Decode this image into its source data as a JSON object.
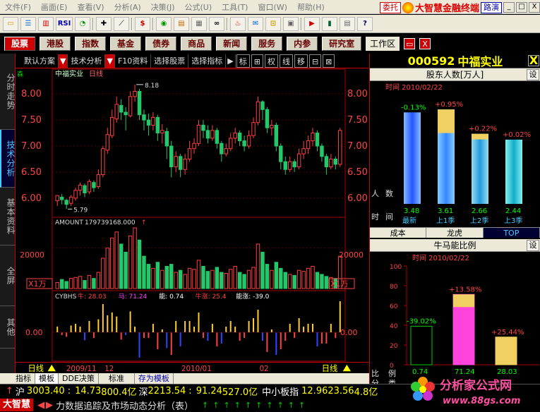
{
  "menu": {
    "items": [
      "文件(F)",
      "画面(E)",
      "查看(V)",
      "分析(A)",
      "决策(J)",
      "公式(U)",
      "工具(T)",
      "窗口(W)",
      "帮助(H)"
    ],
    "weituo": "委托",
    "brand": "大智慧金融终端",
    "luyan": "路演",
    "win_min": "_",
    "win_max": "□",
    "win_close": "X"
  },
  "toolbar": {
    "rsi_label": "RSI",
    "dollar_label": "$"
  },
  "categories": [
    "股票",
    "港股",
    "指数",
    "基金",
    "债券",
    "商品",
    "新闻",
    "服务",
    "内参",
    "研究室"
  ],
  "workarea": {
    "label": "工作区",
    "restore": "▭",
    "close": "X"
  },
  "sidetabs": [
    "分时走势",
    "技术分析",
    "基本资料",
    "全屏",
    "其他"
  ],
  "chart_toolbar": {
    "scheme": "默认方案",
    "tech": "技术分析",
    "f10": "F10资料",
    "select_stock": "选择股票",
    "select_indicator": "选择指标",
    "biao": "标",
    "plus": "⊞",
    "quan": "权",
    "xian": "线",
    "yi": "移",
    "sq1": "⊟",
    "sq2": "⊠"
  },
  "chart_data": [
    {
      "type": "candlestick",
      "title": "中福实业",
      "period": "日线",
      "sen_label": "森",
      "ylim": [
        5.7,
        8.3
      ],
      "yticks": [
        "8.00",
        "7.50",
        "7.00",
        "6.50",
        "6.00"
      ],
      "high_label": "8.18",
      "low_label": "5.79",
      "candles": [
        [
          5.95,
          6.05,
          5.85,
          6.0
        ],
        [
          6.02,
          5.97,
          5.88,
          6.08
        ],
        [
          5.96,
          5.88,
          5.79,
          5.99
        ],
        [
          5.9,
          6.02,
          5.85,
          6.06
        ],
        [
          6.0,
          6.15,
          5.95,
          6.2
        ],
        [
          6.15,
          6.25,
          6.05,
          6.3
        ],
        [
          6.24,
          6.1,
          6.02,
          6.28
        ],
        [
          6.12,
          6.32,
          6.08,
          6.36
        ],
        [
          6.3,
          6.2,
          6.12,
          6.34
        ],
        [
          6.22,
          6.45,
          6.18,
          6.55
        ],
        [
          6.45,
          6.95,
          6.4,
          7.0
        ],
        [
          6.92,
          7.22,
          6.85,
          7.35
        ],
        [
          7.2,
          7.55,
          7.15,
          7.7
        ],
        [
          7.52,
          7.8,
          7.45,
          7.95
        ],
        [
          7.78,
          7.65,
          7.5,
          7.9
        ],
        [
          7.65,
          7.6,
          7.3,
          7.75
        ],
        [
          7.58,
          7.95,
          7.55,
          8.05
        ],
        [
          7.95,
          8.05,
          7.85,
          8.18
        ],
        [
          8.05,
          7.6,
          7.5,
          8.1
        ],
        [
          7.6,
          7.5,
          7.3,
          7.7
        ],
        [
          7.5,
          7.4,
          7.2,
          7.62
        ],
        [
          7.4,
          7.55,
          7.3,
          7.65
        ],
        [
          7.55,
          7.25,
          7.1,
          7.6
        ],
        [
          7.25,
          7.3,
          7.05,
          7.42
        ],
        [
          7.28,
          7.0,
          6.75,
          7.35
        ],
        [
          7.0,
          6.6,
          6.4,
          7.1
        ],
        [
          6.6,
          6.8,
          6.5,
          6.9
        ],
        [
          6.8,
          6.55,
          6.4,
          6.85
        ],
        [
          6.55,
          6.75,
          6.45,
          6.85
        ],
        [
          6.75,
          6.95,
          6.7,
          7.1
        ],
        [
          6.95,
          7.05,
          6.85,
          7.15
        ],
        [
          7.05,
          7.4,
          7.0,
          7.5
        ],
        [
          7.4,
          7.3,
          7.15,
          7.5
        ],
        [
          7.3,
          7.15,
          7.05,
          7.4
        ],
        [
          7.15,
          7.3,
          7.1,
          7.4
        ],
        [
          7.3,
          7.05,
          6.95,
          7.35
        ],
        [
          7.05,
          6.85,
          6.7,
          7.1
        ],
        [
          6.85,
          6.95,
          6.8,
          7.05
        ],
        [
          6.95,
          7.15,
          6.9,
          7.25
        ],
        [
          7.15,
          7.25,
          7.05,
          7.35
        ],
        [
          7.25,
          7.1,
          7.0,
          7.3
        ],
        [
          7.1,
          7.0,
          6.9,
          7.2
        ],
        [
          7.0,
          7.2,
          6.95,
          7.3
        ],
        [
          7.2,
          7.45,
          7.15,
          7.55
        ],
        [
          7.45,
          7.85,
          7.4,
          7.95
        ],
        [
          7.85,
          7.7,
          7.5,
          7.88
        ],
        [
          7.7,
          7.35,
          7.25,
          7.75
        ],
        [
          7.35,
          7.4,
          7.2,
          7.5
        ],
        [
          7.4,
          7.0,
          6.9,
          7.45
        ],
        [
          7.0,
          6.7,
          6.55,
          7.05
        ],
        [
          6.7,
          6.55,
          6.45,
          6.8
        ],
        [
          6.55,
          6.7,
          6.5,
          6.8
        ],
        [
          6.7,
          6.6,
          6.5,
          6.75
        ],
        [
          6.6,
          6.85,
          6.55,
          6.95
        ],
        [
          6.85,
          6.95,
          6.75,
          7.1
        ],
        [
          6.95,
          7.1,
          6.85,
          7.2
        ],
        [
          7.1,
          7.25,
          7.0,
          7.35
        ],
        [
          7.25,
          7.0,
          6.9,
          7.3
        ],
        [
          7.0,
          6.8,
          6.7,
          7.05
        ],
        [
          6.8,
          6.6,
          6.45,
          6.85
        ],
        [
          6.6,
          6.75,
          6.55,
          6.85
        ],
        [
          6.75,
          6.65,
          6.55,
          6.8
        ],
        [
          6.65,
          7.3,
          6.6,
          7.35
        ]
      ]
    },
    {
      "type": "bar",
      "title": "AMOUNT",
      "value_label": "179739168.000",
      "ytick": "20000",
      "unit_label": "X1万",
      "ylim": [
        0,
        30000
      ],
      "values": [
        3000,
        4500,
        3500,
        5000,
        5500,
        6000,
        4000,
        6500,
        5000,
        8000,
        15000,
        20000,
        25000,
        28000,
        22000,
        18000,
        26000,
        30000,
        24000,
        16000,
        12000,
        10000,
        13000,
        9000,
        11000,
        12000,
        8000,
        9000,
        7000,
        10000,
        9500,
        14000,
        11000,
        8500,
        9000,
        10500,
        8000,
        7500,
        9500,
        11000,
        8000,
        7000,
        9000,
        10500,
        22000,
        18000,
        12000,
        9000,
        13000,
        10000,
        8000,
        7000,
        6500,
        9000,
        8500,
        10000,
        11000,
        8000,
        7000,
        6000,
        5500,
        5000,
        16000
      ]
    },
    {
      "type": "bar",
      "title": "CYBHS",
      "legend": [
        {
          "label": "牛: 28.03",
          "color": "#ff4040"
        },
        {
          "label": "马: 71.24",
          "color": "#ff40ff"
        },
        {
          "label": "能: 0.74",
          "color": "#ffffff"
        },
        {
          "label": "牛涨: 25.4",
          "color": "#ff4040"
        },
        {
          "label": "能涨: -39.0",
          "color": "#ffffff"
        }
      ],
      "ytick": "0.00"
    }
  ],
  "time_axis": {
    "left": "日线",
    "right": "日线",
    "labels": [
      "2009/11",
      "12",
      "2010/01",
      "02"
    ]
  },
  "bottom_tabs": [
    "指标",
    "模板",
    "DDE决策",
    "标准",
    "存为模板"
  ],
  "right": {
    "code": "000592",
    "name": "中福实业",
    "close": "X",
    "holders": {
      "title": "股东人数[万人]",
      "set": "设",
      "time": "时间 2010/02/22",
      "y_labels": [
        "人",
        "数",
        "时",
        "间"
      ],
      "bars": [
        {
          "pct": "-0.13%",
          "value": "3.48",
          "label": "最新",
          "fill": 0.94
        },
        {
          "pct": "+0.95%",
          "value": "3.61",
          "label": "上1季",
          "fill": 0.97
        },
        {
          "pct": "+0.22%",
          "value": "2.66",
          "label": "上2季",
          "fill": 0.72
        },
        {
          "pct": "+0.02%",
          "value": "2.44",
          "label": "上3季",
          "fill": 0.66
        }
      ]
    },
    "tabs": [
      "成本",
      "龙虎",
      "TOP"
    ],
    "bullbear": {
      "title": "牛马能比例",
      "set": "设",
      "time": "时间 2010/02/22",
      "yticks": [
        "100",
        "80",
        "60",
        "40",
        "20",
        "0"
      ],
      "side_labels": [
        "比",
        "例",
        "分",
        "类"
      ],
      "bars": [
        {
          "pct": "-39.02%",
          "value": "0.74"
        },
        {
          "pct": "+13.58%",
          "value": "71.24"
        },
        {
          "pct": "+25.44%",
          "value": "28.03"
        }
      ]
    }
  },
  "status": {
    "hu_label": "沪",
    "hu_value": "3003.40",
    "hu_change": "14.73",
    "hu_amount": "800.4亿",
    "shen_label": "深",
    "shen_value": "2213.54",
    "shen_change": "91.24",
    "shen_amount": "527.0亿",
    "zx_label": "中小板指",
    "zx_value": "12.96",
    "zx_change": "23.56",
    "zx_amount": "4.8亿",
    "app_label": "大智慧",
    "ticker": "力数据追踪及市场动态分析（表）"
  },
  "watermark": {
    "brand": "分析家公式网",
    "url": "www.88gs.com"
  }
}
